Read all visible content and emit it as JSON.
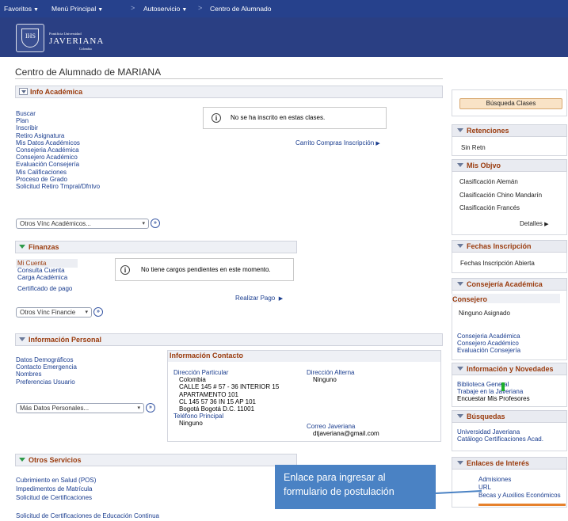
{
  "topnav": {
    "favoritos": "Favoritos",
    "menu_principal": "Menú Principal",
    "autoservicio": "Autoservicio",
    "centro": "Centro de Alumnado"
  },
  "logo": {
    "small": "Pontificia Universidad",
    "main": "JAVERIANA",
    "sub": "Colombia"
  },
  "page_title": "Centro de Alumnado de MARIANA",
  "info_academica": {
    "header": "Info Académica",
    "links": [
      "Buscar",
      "Plan",
      "Inscribir",
      "Retiro Asignatura",
      "Mis Datos Académicos",
      "Consejeria Académica",
      "Consejero Académico",
      "Evaluación Consejería",
      "Mis Calificaciones",
      "Proceso de Grado",
      "Solicitud Retiro Tmpral/Dfntvo"
    ],
    "message": "No se ha inscrito en estas clases.",
    "cart_link": "Carrito Compras Inscripción",
    "select_value": "Otros Vínc Académicos..."
  },
  "finanzas": {
    "header": "Finanzas",
    "links": [
      "Mi Cuenta",
      "Consulta Cuenta",
      "Carga Académica",
      "Certificado de pago"
    ],
    "message": "No tiene cargos pendientes en este momento.",
    "pay_link": "Realizar Pago",
    "select_value": "Otros Vínc Financie"
  },
  "info_personal": {
    "header": "Información Personal",
    "links": [
      "Datos Demográficos",
      "Contacto Emergencia",
      "Nombres",
      "Preferencias Usuario"
    ],
    "select_value": "Más Datos Personales...",
    "contacto": {
      "title": "Información Contacto",
      "dir_particular_label": "Dirección Particular",
      "dir_particular_lines": [
        "Colombia",
        "CALLE 145 # 57 - 36 INTERIOR 15",
        "APARTAMENTO 101",
        "CL 145    57  36 IN 15 AP 101",
        "Bogotá Bogotá D.C. 11001"
      ],
      "dir_alterna_label": "Dirección Alterna",
      "dir_alterna_value": "Ninguno",
      "telefono_label": "Teléfono Principal",
      "telefono_value": "Ninguno",
      "correo_label": "Correo Javeriana",
      "correo_value": "dtjaveriana@gmail.com"
    }
  },
  "otros_servicios": {
    "header": "Otros Servicios",
    "links": [
      "Cubrimiento en Salud (POS)",
      "Impedimentos de Matrícula",
      "Solicitud de Certificaciones"
    ],
    "link_bottom": "Solicitud de Certificaciones de Educación Continua"
  },
  "right": {
    "busqueda_clases": "Búsqueda Clases",
    "retenciones": {
      "header": "Retenciones",
      "value": "Sin Retn"
    },
    "mis_objvo": {
      "header": "Mis Objvo",
      "items": [
        "Clasificación Alemán",
        "Clasificación Chino Mandarín",
        "Clasificación Francés"
      ],
      "detalles": "Detalles"
    },
    "fechas": {
      "header": "Fechas Inscripción",
      "link": "Fechas Inscripción Abierta"
    },
    "consejeria": {
      "header": "Consejería Académica",
      "sub": "Consejero",
      "value": "Ninguno Asignado",
      "links": [
        "Consejeria Académica",
        "Consejero Académico",
        "Evaluación Consejería"
      ]
    },
    "novedades": {
      "header": "Información y Novedades",
      "links": [
        "Biblioteca General",
        "Trabaje en la Javeriana"
      ],
      "text": "Encuestar Mis Profesores"
    },
    "busquedas": {
      "header": "Búsquedas",
      "links": [
        "Universidad Javeriana",
        "Catálogo Certificaciones Acad."
      ]
    },
    "enlaces": {
      "header": "Enlaces de Interés",
      "links": [
        "Admisiones",
        "URL",
        "Becas y Auxilios Económicos"
      ]
    }
  },
  "callout": {
    "line1": "Enlace para ingresar al",
    "line2": "formulario de postulación"
  },
  "colors": {
    "nav": "#26418c",
    "header_text": "#9a3b0d",
    "link": "#1a3d8f",
    "callout": "#4a82c4",
    "highlight": "#e6812c"
  }
}
